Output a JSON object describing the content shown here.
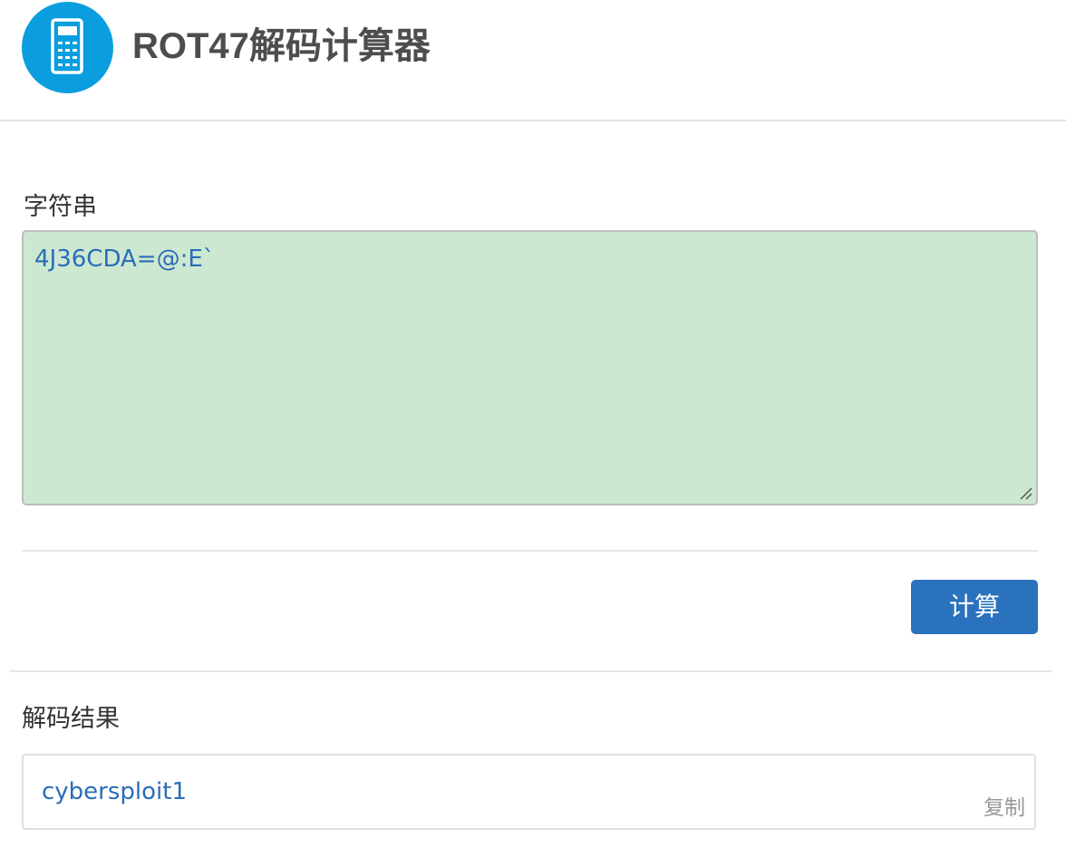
{
  "header": {
    "title": "ROT47解码计算器",
    "logo_icon": "calculator-icon",
    "brand_color": "#0a9ede"
  },
  "input": {
    "label": "字符串",
    "value": "4J36CDA=@:E`",
    "background_color": "#cde8d0"
  },
  "actions": {
    "calculate_label": "计算",
    "button_color": "#2a72bd"
  },
  "result": {
    "label": "解码结果",
    "value": "cybersploit1",
    "copy_label": "复制"
  }
}
